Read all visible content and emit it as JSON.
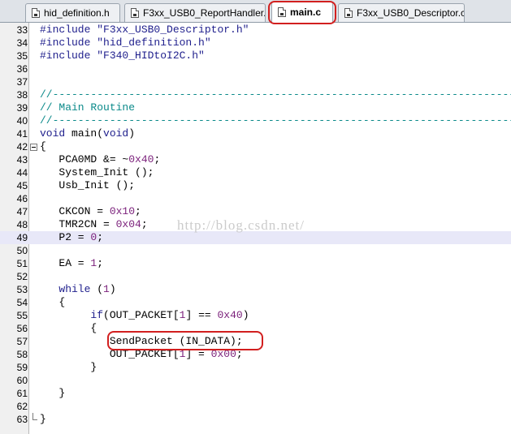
{
  "tabs": [
    {
      "label": "hid_definition.h",
      "active": false
    },
    {
      "label": "F3xx_USB0_ReportHandler.c",
      "active": false
    },
    {
      "label": "main.c",
      "active": true
    },
    {
      "label": "F3xx_USB0_Descriptor.c",
      "active": false
    }
  ],
  "editor": {
    "current_line": "49",
    "lines": [
      {
        "n": "33",
        "tokens": [
          {
            "t": "#include ",
            "c": "pp"
          },
          {
            "t": "\"F3xx_USB0_Descriptor.h\"",
            "c": "str"
          }
        ]
      },
      {
        "n": "34",
        "tokens": [
          {
            "t": "#include ",
            "c": "pp"
          },
          {
            "t": "\"hid_definition.h\"",
            "c": "str"
          }
        ]
      },
      {
        "n": "35",
        "tokens": [
          {
            "t": "#include ",
            "c": "pp"
          },
          {
            "t": "\"F340_HIDtoI2C.h\"",
            "c": "str"
          }
        ]
      },
      {
        "n": "36",
        "tokens": []
      },
      {
        "n": "37",
        "tokens": []
      },
      {
        "n": "38",
        "tokens": [
          {
            "t": "//-------------------------------------------------------------------------",
            "c": "cmt"
          }
        ]
      },
      {
        "n": "39",
        "tokens": [
          {
            "t": "// Main Routine",
            "c": "cmt"
          }
        ]
      },
      {
        "n": "40",
        "tokens": [
          {
            "t": "//-------------------------------------------------------------------------",
            "c": "cmt"
          }
        ]
      },
      {
        "n": "41",
        "tokens": [
          {
            "t": "void",
            "c": "kw"
          },
          {
            "t": " main(",
            "c": ""
          },
          {
            "t": "void",
            "c": "kw"
          },
          {
            "t": ")",
            "c": ""
          }
        ]
      },
      {
        "n": "42",
        "fold": "open",
        "tokens": [
          {
            "t": "{",
            "c": ""
          }
        ]
      },
      {
        "n": "43",
        "tokens": [
          {
            "t": "   PCA0MD &= ~",
            "c": ""
          },
          {
            "t": "0x40",
            "c": "num"
          },
          {
            "t": ";",
            "c": ""
          }
        ]
      },
      {
        "n": "44",
        "tokens": [
          {
            "t": "   System_Init ();",
            "c": ""
          }
        ]
      },
      {
        "n": "45",
        "tokens": [
          {
            "t": "   Usb_Init ();",
            "c": ""
          }
        ]
      },
      {
        "n": "46",
        "tokens": []
      },
      {
        "n": "47",
        "tokens": [
          {
            "t": "   CKCON = ",
            "c": ""
          },
          {
            "t": "0x10",
            "c": "num"
          },
          {
            "t": ";",
            "c": ""
          }
        ]
      },
      {
        "n": "48",
        "tokens": [
          {
            "t": "   TMR2CN = ",
            "c": ""
          },
          {
            "t": "0x04",
            "c": "num"
          },
          {
            "t": ";",
            "c": ""
          }
        ]
      },
      {
        "n": "49",
        "tokens": [
          {
            "t": "   P2 = ",
            "c": ""
          },
          {
            "t": "0",
            "c": "num"
          },
          {
            "t": ";",
            "c": ""
          }
        ]
      },
      {
        "n": "50",
        "tokens": []
      },
      {
        "n": "51",
        "tokens": [
          {
            "t": "   EA = ",
            "c": ""
          },
          {
            "t": "1",
            "c": "num"
          },
          {
            "t": ";",
            "c": ""
          }
        ]
      },
      {
        "n": "52",
        "tokens": []
      },
      {
        "n": "53",
        "tokens": [
          {
            "t": "   ",
            "c": ""
          },
          {
            "t": "while",
            "c": "kw"
          },
          {
            "t": " (",
            "c": ""
          },
          {
            "t": "1",
            "c": "num"
          },
          {
            "t": ")",
            "c": ""
          }
        ]
      },
      {
        "n": "54",
        "tokens": [
          {
            "t": "   {",
            "c": ""
          }
        ]
      },
      {
        "n": "55",
        "tokens": [
          {
            "t": "        ",
            "c": ""
          },
          {
            "t": "if",
            "c": "kw"
          },
          {
            "t": "(OUT_PACKET[",
            "c": ""
          },
          {
            "t": "1",
            "c": "num"
          },
          {
            "t": "] == ",
            "c": ""
          },
          {
            "t": "0x40",
            "c": "num"
          },
          {
            "t": ")",
            "c": ""
          }
        ]
      },
      {
        "n": "56",
        "tokens": [
          {
            "t": "        {",
            "c": ""
          }
        ]
      },
      {
        "n": "57",
        "tokens": [
          {
            "t": "           SendPacket (IN_DATA);",
            "c": ""
          }
        ]
      },
      {
        "n": "58",
        "tokens": [
          {
            "t": "           OUT_PACKET[",
            "c": ""
          },
          {
            "t": "1",
            "c": "num"
          },
          {
            "t": "] = ",
            "c": ""
          },
          {
            "t": "0x00",
            "c": "num"
          },
          {
            "t": ";",
            "c": ""
          }
        ]
      },
      {
        "n": "59",
        "tokens": [
          {
            "t": "        }",
            "c": ""
          }
        ]
      },
      {
        "n": "60",
        "tokens": []
      },
      {
        "n": "61",
        "tokens": [
          {
            "t": "   }",
            "c": ""
          }
        ]
      },
      {
        "n": "62",
        "tokens": []
      },
      {
        "n": "63",
        "fold": "end",
        "tokens": [
          {
            "t": "}",
            "c": ""
          }
        ]
      }
    ]
  },
  "watermark": "http://blog.csdn.net/",
  "colors": {
    "annotation": "#d21f1f",
    "comment": "#0b8a8a",
    "number": "#7a1f7a",
    "keyword": "#1e1e8c",
    "current_line_bg": "#e8e8f8"
  }
}
